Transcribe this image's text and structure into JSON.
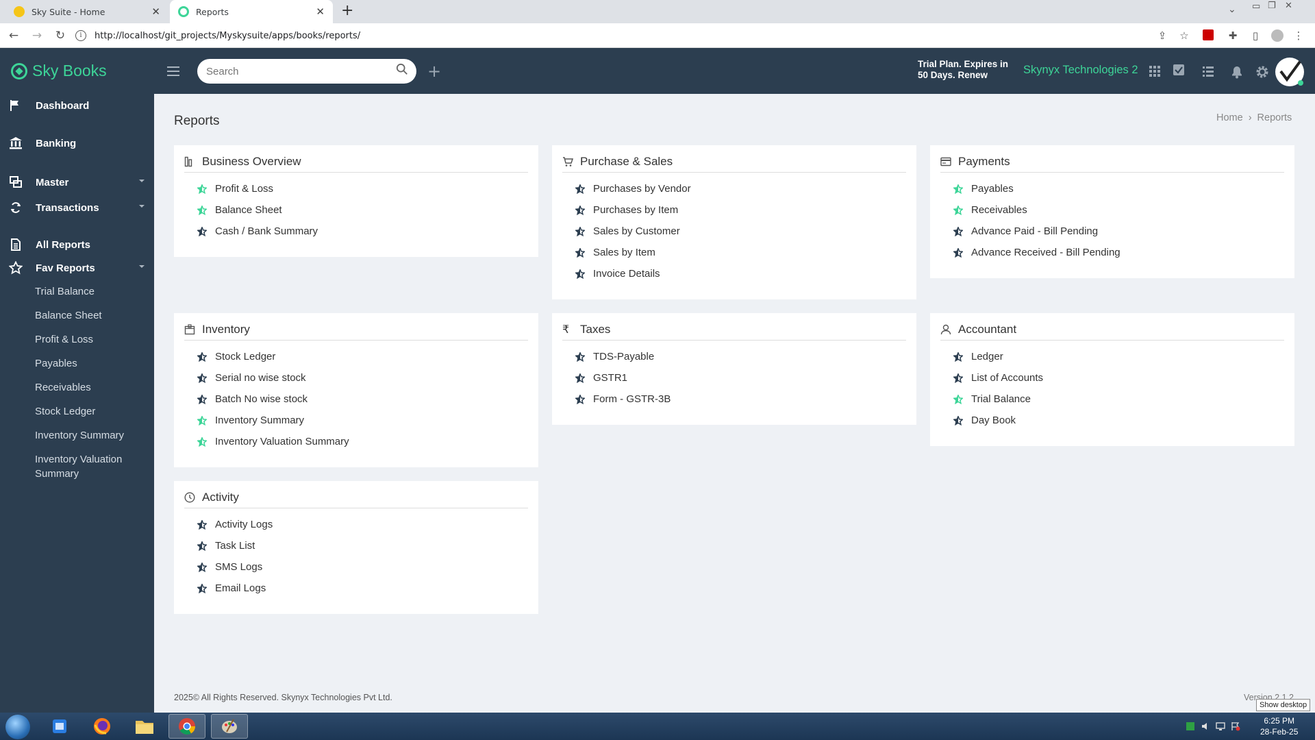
{
  "browser": {
    "tabs": [
      {
        "title": "Sky Suite - Home",
        "favicon_color": "#f5c518"
      },
      {
        "title": "Reports",
        "favicon_color": "#3dd598"
      }
    ],
    "close_glyph": "✕",
    "new_tab_glyph": "+",
    "url": "http://localhost/git_projects/Myskysuite/apps/books/reports/"
  },
  "header": {
    "brand": "Sky Books",
    "search_placeholder": "Search",
    "add_glyph": "+",
    "trial_line1": "Trial Plan. Expires in",
    "trial_line2": "50 Days. Renew",
    "company": "Skynyx Technologies 2",
    "icons": [
      "apps-grid-icon",
      "task-check-icon",
      "list-icon",
      "bell-icon",
      "gear-icon",
      "avatar-check-icon"
    ]
  },
  "sidebar": {
    "items": [
      {
        "label": "Dashboard",
        "icon": "flag-icon"
      },
      {
        "label": "Banking",
        "icon": "bank-icon"
      },
      {
        "label": "Master",
        "icon": "master-icon",
        "caret": true
      },
      {
        "label": "Transactions",
        "icon": "transactions-icon",
        "caret": true
      },
      {
        "label": "All Reports",
        "icon": "document-icon"
      },
      {
        "label": "Fav Reports",
        "icon": "star-icon",
        "caret": true
      }
    ],
    "fav_reports": [
      "Trial Balance",
      "Balance Sheet",
      "Profit & Loss",
      "Payables",
      "Receivables",
      "Stock Ledger",
      "Inventory Summary",
      "Inventory Valuation Summary"
    ]
  },
  "page": {
    "title": "Reports",
    "breadcrumb": {
      "home": "Home",
      "separator": "›",
      "current": "Reports"
    }
  },
  "cards": {
    "business_overview": {
      "title": "Business Overview",
      "items": [
        {
          "label": "Profit & Loss",
          "fav": true
        },
        {
          "label": "Balance Sheet",
          "fav": true
        },
        {
          "label": "Cash / Bank Summary",
          "fav": false
        }
      ]
    },
    "purchase_sales": {
      "title": "Purchase & Sales",
      "items": [
        {
          "label": "Purchases by Vendor",
          "fav": false
        },
        {
          "label": "Purchases by Item",
          "fav": false
        },
        {
          "label": "Sales by Customer",
          "fav": false
        },
        {
          "label": "Sales by Item",
          "fav": false
        },
        {
          "label": "Invoice Details",
          "fav": false
        }
      ]
    },
    "payments": {
      "title": "Payments",
      "items": [
        {
          "label": "Payables",
          "fav": true
        },
        {
          "label": "Receivables",
          "fav": true
        },
        {
          "label": "Advance Paid - Bill Pending",
          "fav": false
        },
        {
          "label": "Advance Received - Bill Pending",
          "fav": false
        }
      ]
    },
    "inventory": {
      "title": "Inventory",
      "items": [
        {
          "label": "Stock Ledger",
          "fav": false
        },
        {
          "label": "Serial no wise stock",
          "fav": false
        },
        {
          "label": "Batch No wise stock",
          "fav": false
        },
        {
          "label": "Inventory Summary",
          "fav": true
        },
        {
          "label": "Inventory Valuation Summary",
          "fav": true
        }
      ]
    },
    "taxes": {
      "title": "Taxes",
      "icon_glyph": "₹",
      "items": [
        {
          "label": "TDS-Payable",
          "fav": false
        },
        {
          "label": "GSTR1",
          "fav": false
        },
        {
          "label": "Form - GSTR-3B",
          "fav": false
        }
      ]
    },
    "accountant": {
      "title": "Accountant",
      "items": [
        {
          "label": "Ledger",
          "fav": false
        },
        {
          "label": "List of Accounts",
          "fav": false
        },
        {
          "label": "Trial Balance",
          "fav": true
        },
        {
          "label": "Day Book",
          "fav": false
        }
      ]
    },
    "activity": {
      "title": "Activity",
      "items": [
        {
          "label": "Activity Logs",
          "fav": false
        },
        {
          "label": "Task List",
          "fav": false
        },
        {
          "label": "SMS Logs",
          "fav": false
        },
        {
          "label": "Email Logs",
          "fav": false
        }
      ]
    }
  },
  "footer": {
    "copyright": "2025© All Rights Reserved. Skynyx Technologies Pvt Ltd.",
    "version": "Version 2.1.2"
  },
  "taskbar": {
    "show_desktop": "Show desktop",
    "time": "6:25 PM",
    "date": "28-Feb-25"
  },
  "colors": {
    "accent": "#3dd598",
    "sidebar_bg": "#2c3e50",
    "page_bg": "#eef1f5",
    "fav_star": "#3dd598",
    "plain_star": "#2c3e50"
  }
}
